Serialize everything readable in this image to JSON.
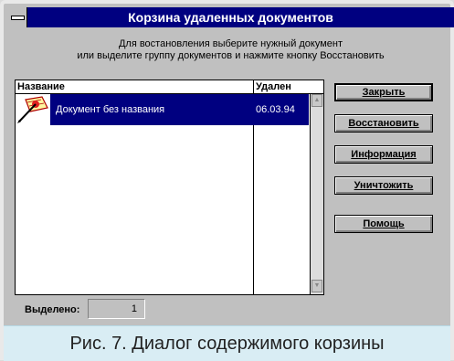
{
  "window": {
    "title": "Корзина удаленных документов",
    "instructions": [
      "Для востановления выберите нужный документ",
      "или выделите группу документов и нажмите кнопку Восстановить"
    ]
  },
  "list": {
    "headers": {
      "name": "Название",
      "deleted": "Удален"
    },
    "rows": [
      {
        "name": "Документ без названия",
        "deleted": "06.03.94",
        "icon": "document-pen-icon",
        "selected": true
      }
    ]
  },
  "buttons": {
    "close": "Закрыть",
    "restore": "Восстановить",
    "info": "Информация",
    "destroy": "Уничтожить",
    "help": "Помощь"
  },
  "selection": {
    "label": "Выделено:",
    "value": "1"
  },
  "caption": "Рис. 7. Диалог содержимого корзины",
  "colors": {
    "titlebar": "#000080",
    "selection": "#000080",
    "dialog": "#c0c0c0",
    "caption_bg": "#d9edf4"
  }
}
